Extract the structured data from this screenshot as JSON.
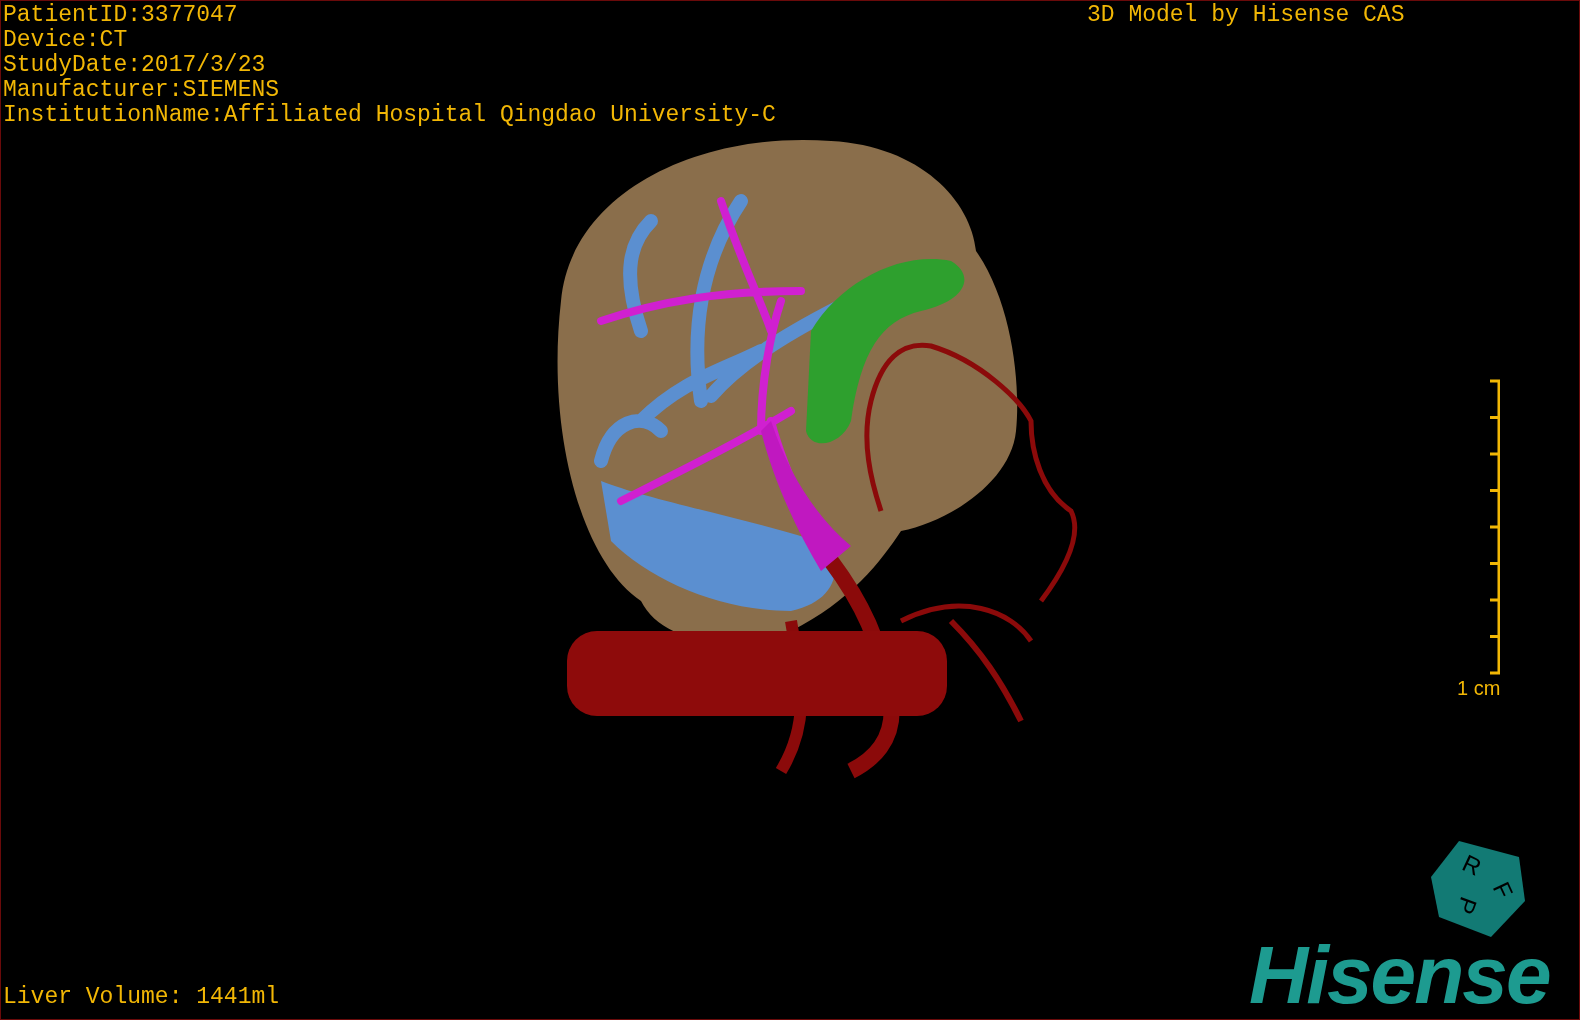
{
  "info_lines": [
    "PatientID:3377047",
    "Device:CT",
    "StudyDate:2017/3/23",
    "Manufacturer:SIEMENS",
    "InstitutionName:Affiliated Hospital Qingdao University-C"
  ],
  "credit": "3D Model by Hisense CAS",
  "scale_bar": {
    "label": "1 cm"
  },
  "orientation_cube": {
    "faces": [
      "R",
      "F",
      "P"
    ]
  },
  "liver_volume": "Liver Volume: 1441ml",
  "logo": "Hisense"
}
